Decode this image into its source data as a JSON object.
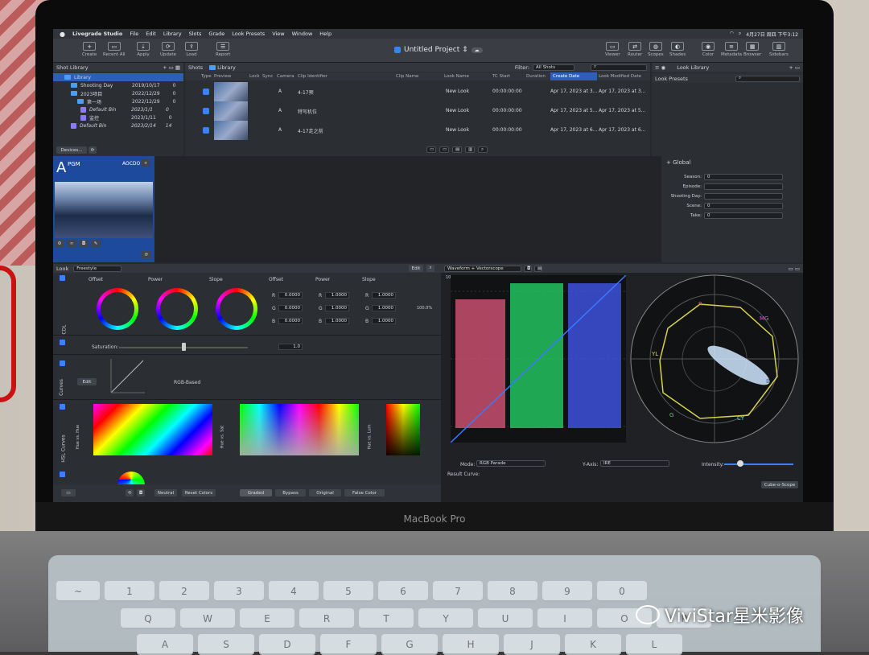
{
  "menubar": {
    "app": "Livegrade Studio",
    "items": [
      "File",
      "Edit",
      "Library",
      "Slots",
      "Grade",
      "Look Presets",
      "View",
      "Window",
      "Help"
    ],
    "clock": "4月27日 周四 下午3:12"
  },
  "toolbar": {
    "left": [
      "Create",
      "Recent All",
      "Apply",
      "Update",
      "Load",
      "Report"
    ],
    "right": [
      "Viewer",
      "Router",
      "Scopes",
      "Shades",
      "Color",
      "Metadata",
      "Browser",
      "Sidebars"
    ],
    "project_title": "Untitled Project ⇕"
  },
  "shot_library": {
    "title": "Shot Library",
    "devices_button": "Devices...",
    "tree": [
      {
        "name": "Library",
        "date": "",
        "count": "",
        "kind": "root"
      },
      {
        "name": "Shooting Day",
        "date": "2019/10/17",
        "count": "0",
        "kind": "folder"
      },
      {
        "name": "2023项目",
        "date": "2022/12/29",
        "count": "0",
        "kind": "folder"
      },
      {
        "name": "第一场",
        "date": "2022/12/29",
        "count": "0",
        "kind": "folder"
      },
      {
        "name": "Default Bin",
        "date": "2023/1/1",
        "count": "0",
        "kind": "bin"
      },
      {
        "name": "监控",
        "date": "2023/1/11",
        "count": "0",
        "kind": "bin"
      },
      {
        "name": "Default Bin",
        "date": "2023/2/14",
        "count": "14",
        "kind": "bin"
      }
    ]
  },
  "shots": {
    "title": "Shots",
    "breadcrumb": "Library",
    "filter_label": "Filter:",
    "filter_value": "All Shots",
    "columns": [
      "Type",
      "Preview",
      "Lock",
      "Sync",
      "Camera",
      "Clip Identifier",
      "Clip Name",
      "Look Name",
      "TC Start",
      "Duration",
      "Create Date",
      "Look Modified Date"
    ],
    "rows": [
      {
        "camera": "A",
        "clip_id": "4-17预",
        "look": "New Look",
        "tc": "00:00:00:00",
        "create": "Apr 17, 2023 at 3...",
        "modified": "Apr 17, 2023 at 3..."
      },
      {
        "camera": "A",
        "clip_id": "特写机位",
        "look": "New Look",
        "tc": "00:00:00:00",
        "create": "Apr 17, 2023 at 5...",
        "modified": "Apr 17, 2023 at 5..."
      },
      {
        "camera": "A",
        "clip_id": "4-17走之前",
        "look": "New Look",
        "tc": "00:00:00:00",
        "create": "Apr 17, 2023 at 6...",
        "modified": "Apr 17, 2023 at 6..."
      }
    ]
  },
  "look_library": {
    "title": "Look Library",
    "presets": "Look Presets"
  },
  "monitor": {
    "slot": "A",
    "label": "PGM",
    "source": "AOCDO"
  },
  "global": {
    "title": "Global",
    "fields": [
      {
        "label": "Season:",
        "value": "0"
      },
      {
        "label": "Episode:",
        "value": ""
      },
      {
        "label": "Shooting Day:",
        "value": ""
      },
      {
        "label": "Scene:",
        "value": "0"
      },
      {
        "label": "Take:",
        "value": "0"
      }
    ]
  },
  "look_panel": {
    "look_label": "Look",
    "mode": "Freestyle",
    "edit": "Edit",
    "cdl_tag": "CDL",
    "wheels": [
      "Offset",
      "Power",
      "Slope"
    ],
    "offset": {
      "label": "Offset",
      "R": "0.0000",
      "G": "0.0000",
      "B": "0.0000"
    },
    "power": {
      "label": "Power",
      "R": "1.0000",
      "G": "1.0000",
      "B": "1.0000"
    },
    "slope": {
      "label": "Slope",
      "R": "1.0000",
      "G": "1.0000",
      "B": "1.0000"
    },
    "saturation_label": "Saturation:",
    "saturation_value": "1.0",
    "curves_tag": "Curves",
    "curves_edit": "Edit",
    "curves_mode": "RGB-Based",
    "hsl_tag": "HSL Curves",
    "hsl_labels": [
      "Hue vs. Hue",
      "Hue vs. Sat",
      "Hue vs. Lum"
    ],
    "percent": "100.0%"
  },
  "bottom_bar": {
    "neutral": "Neutral",
    "reset": "Reset Colors",
    "graded": "Graded",
    "bypass": "Bypass",
    "original": "Original",
    "false_color": "False Color",
    "cube": "Cube-o-Scope"
  },
  "scopes": {
    "title": "Waveform + Vectorscope",
    "mode_label": "Mode:",
    "mode_value": "RGB Parade",
    "yaxis_label": "Y-Axis:",
    "yaxis_value": "IRE",
    "intensity_label": "Intensity:",
    "result_label": "Result Curve:",
    "ire_top": "100",
    "vector_labels": [
      "R",
      "MG",
      "B",
      "CY",
      "G",
      "YL"
    ]
  },
  "brand": "MacBook Pro",
  "watermark": "ViviStar星米影像",
  "keys_row1": [
    "Q",
    "W",
    "E",
    "R",
    "T",
    "Y",
    "U",
    "I",
    "O",
    "P"
  ],
  "keys_row2": [
    "A",
    "S",
    "D",
    "F",
    "G",
    "H",
    "J",
    "K",
    "L"
  ],
  "keys_row0": [
    "~",
    "1",
    "2",
    "3",
    "4",
    "5",
    "6",
    "7",
    "8",
    "9",
    "0"
  ]
}
